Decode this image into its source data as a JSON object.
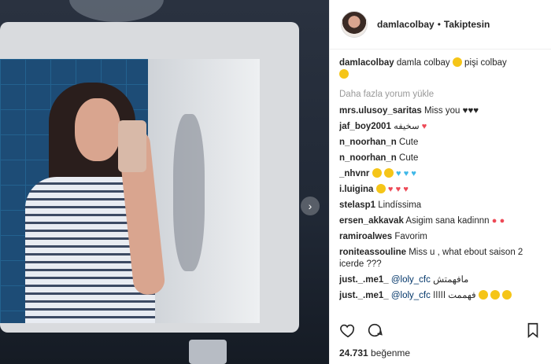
{
  "header": {
    "username": "damlacolbay",
    "separator": "•",
    "follow_status": "Takiptesin"
  },
  "caption": {
    "username": "damlacolbay",
    "text_a": "damla colbay",
    "text_b": "pişi colbay"
  },
  "load_more": "Daha fazla yorum yükle",
  "comments": [
    {
      "user": "mrs.ulusoy_saritas",
      "text": "Miss you ♥♥♥"
    },
    {
      "user": "jaf_boy2001",
      "text": "سخيفه"
    },
    {
      "user": "n_noorhan_n",
      "text": "Cute"
    },
    {
      "user": "n_noorhan_n",
      "text": "Cute"
    },
    {
      "user": "_nhvnr",
      "text": ""
    },
    {
      "user": "i.luigina",
      "text": ""
    },
    {
      "user": "stelasp1",
      "text": "Lindíssima"
    },
    {
      "user": "ersen_akkavak",
      "text": "Asigim sana kadinnn"
    },
    {
      "user": "ramiroalwes",
      "text": "Favorim"
    },
    {
      "user": "roniteassouline",
      "text": "Miss u , what ebout saison 2 icerde ???"
    },
    {
      "user": "just._.me1_",
      "mention": "@loly_cfc",
      "text": "مافهمتش"
    },
    {
      "user": "just._.me1_",
      "mention": "@loly_cfc",
      "text": "فهممت ااااا"
    }
  ],
  "actions": {
    "like_icon": "heart-icon",
    "comment_icon": "comment-icon",
    "save_icon": "bookmark-icon"
  },
  "likes": {
    "count": "24.731",
    "label": "beğenme"
  },
  "colors": {
    "text": "#262626",
    "muted": "#999999",
    "mention": "#003569",
    "heart": "#ed4956"
  }
}
